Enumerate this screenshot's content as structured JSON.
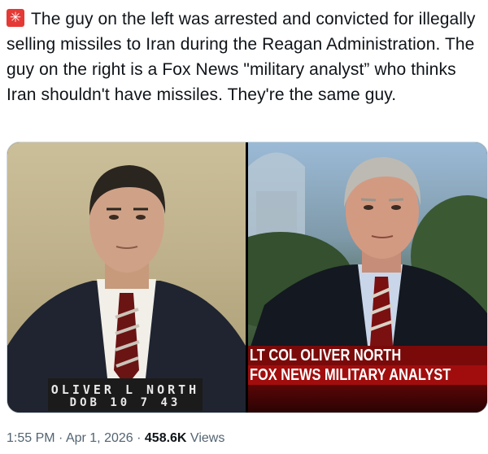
{
  "tweet": {
    "text": "The guy on the left was arrested and convicted for illegally selling missiles to Iran during the Reagan Administration. The guy on the right is a Fox News \"military analyst” who thinks Iran shouldn't have missiles. They're the same guy.",
    "leading_icon": "siren-icon"
  },
  "media": {
    "left_photo": {
      "placard_line1": "OLIVER L NORTH",
      "placard_line2": "DOB 10 7 43"
    },
    "right_photo": {
      "chyron_line1": "LT COL OLIVER NORTH",
      "chyron_line2": "FOX NEWS MILITARY ANALYST"
    }
  },
  "meta": {
    "time": "1:55 PM",
    "separator1": " · ",
    "date": "Apr 1, 2026",
    "separator2": " · ",
    "views_count": "458.6K",
    "views_label": " Views"
  },
  "colors": {
    "text": "#0f1419",
    "secondary": "#536471",
    "chyron_red": "#a10d0d",
    "icon_red": "#e53935"
  }
}
